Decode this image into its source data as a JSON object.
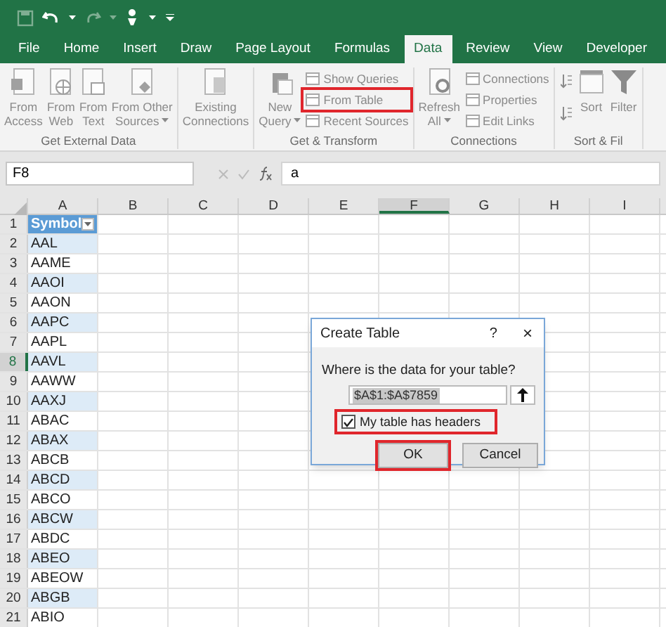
{
  "tabs": [
    {
      "label": "File",
      "selected": false
    },
    {
      "label": "Home",
      "selected": false
    },
    {
      "label": "Insert",
      "selected": false
    },
    {
      "label": "Draw",
      "selected": false
    },
    {
      "label": "Page Layout",
      "selected": false
    },
    {
      "label": "Formulas",
      "selected": false
    },
    {
      "label": "Data",
      "selected": true
    },
    {
      "label": "Review",
      "selected": false
    },
    {
      "label": "View",
      "selected": false
    },
    {
      "label": "Developer",
      "selected": false
    }
  ],
  "ribbon": [
    {
      "label": "Get External Data",
      "items": [
        {
          "kind": "large",
          "lines": [
            "From",
            "Access"
          ]
        },
        {
          "kind": "large",
          "lines": [
            "From",
            "Web"
          ]
        },
        {
          "kind": "large",
          "lines": [
            "From",
            "Text"
          ]
        },
        {
          "kind": "large",
          "lines": [
            "From Other",
            "Sources"
          ],
          "dropdown": true
        }
      ]
    },
    {
      "items": [
        {
          "kind": "large",
          "lines": [
            "Existing",
            "Connections"
          ]
        }
      ]
    },
    {
      "label": "Get & Transform",
      "items": [
        {
          "kind": "large",
          "lines": [
            "New",
            "Query"
          ],
          "dropdown": true
        },
        {
          "kind": "small",
          "label": "Show Queries",
          "highlighted": false
        },
        {
          "kind": "small",
          "label": "From Table",
          "highlighted": true
        },
        {
          "kind": "small",
          "label": "Recent Sources",
          "highlighted": false
        }
      ]
    },
    {
      "label": "Connections",
      "items": [
        {
          "kind": "large",
          "lines": [
            "Refresh",
            "All"
          ],
          "dropdown": true
        },
        {
          "kind": "small",
          "label": "Connections",
          "highlighted": false
        },
        {
          "kind": "small",
          "label": "Properties",
          "highlighted": false
        },
        {
          "kind": "small",
          "label": "Edit Links",
          "highlighted": false
        }
      ]
    },
    {
      "label": "Sort & Fil",
      "items": [
        {
          "kind": "sortpair"
        },
        {
          "kind": "large",
          "lines": [
            "Sort"
          ]
        },
        {
          "kind": "large",
          "lines": [
            "Filter"
          ]
        }
      ]
    }
  ],
  "formula_bar": {
    "name_box": "F8",
    "formula": "a"
  },
  "columns": [
    {
      "label": "A",
      "selected": false
    },
    {
      "label": "B",
      "selected": false
    },
    {
      "label": "C",
      "selected": false
    },
    {
      "label": "D",
      "selected": false
    },
    {
      "label": "E",
      "selected": false
    },
    {
      "label": "F",
      "selected": true
    },
    {
      "label": "G",
      "selected": false
    },
    {
      "label": "H",
      "selected": false
    },
    {
      "label": "I",
      "selected": false
    }
  ],
  "rows": [
    {
      "number": "1",
      "value": "Symbol",
      "selected": false,
      "kind": "header"
    },
    {
      "number": "2",
      "value": "AAL",
      "selected": false
    },
    {
      "number": "3",
      "value": "AAME",
      "selected": false
    },
    {
      "number": "4",
      "value": "AAOI",
      "selected": false
    },
    {
      "number": "5",
      "value": "AAON",
      "selected": false
    },
    {
      "number": "6",
      "value": "AAPC",
      "selected": false
    },
    {
      "number": "7",
      "value": "AAPL",
      "selected": false
    },
    {
      "number": "8",
      "value": "AAVL",
      "selected": true
    },
    {
      "number": "9",
      "value": "AAWW",
      "selected": false
    },
    {
      "number": "10",
      "value": "AAXJ",
      "selected": false
    },
    {
      "number": "11",
      "value": "ABAC",
      "selected": false
    },
    {
      "number": "12",
      "value": "ABAX",
      "selected": false
    },
    {
      "number": "13",
      "value": "ABCB",
      "selected": false
    },
    {
      "number": "14",
      "value": "ABCD",
      "selected": false
    },
    {
      "number": "15",
      "value": "ABCO",
      "selected": false
    },
    {
      "number": "16",
      "value": "ABCW",
      "selected": false
    },
    {
      "number": "17",
      "value": "ABDC",
      "selected": false
    },
    {
      "number": "18",
      "value": "ABEO",
      "selected": false
    },
    {
      "number": "19",
      "value": "ABEOW",
      "selected": false
    },
    {
      "number": "20",
      "value": "ABGB",
      "selected": false
    },
    {
      "number": "21",
      "value": "ABIO",
      "selected": false
    }
  ],
  "dialog": {
    "title": "Create Table",
    "help": "?",
    "close": "×",
    "prompt": "Where is the data for your table?",
    "range": "$A$1:$A$7859",
    "checkbox": {
      "label": "My table has headers",
      "checked": true,
      "highlighted": true
    },
    "buttons": [
      {
        "label": "OK",
        "highlighted": true
      },
      {
        "label": "Cancel",
        "highlighted": false
      }
    ]
  }
}
